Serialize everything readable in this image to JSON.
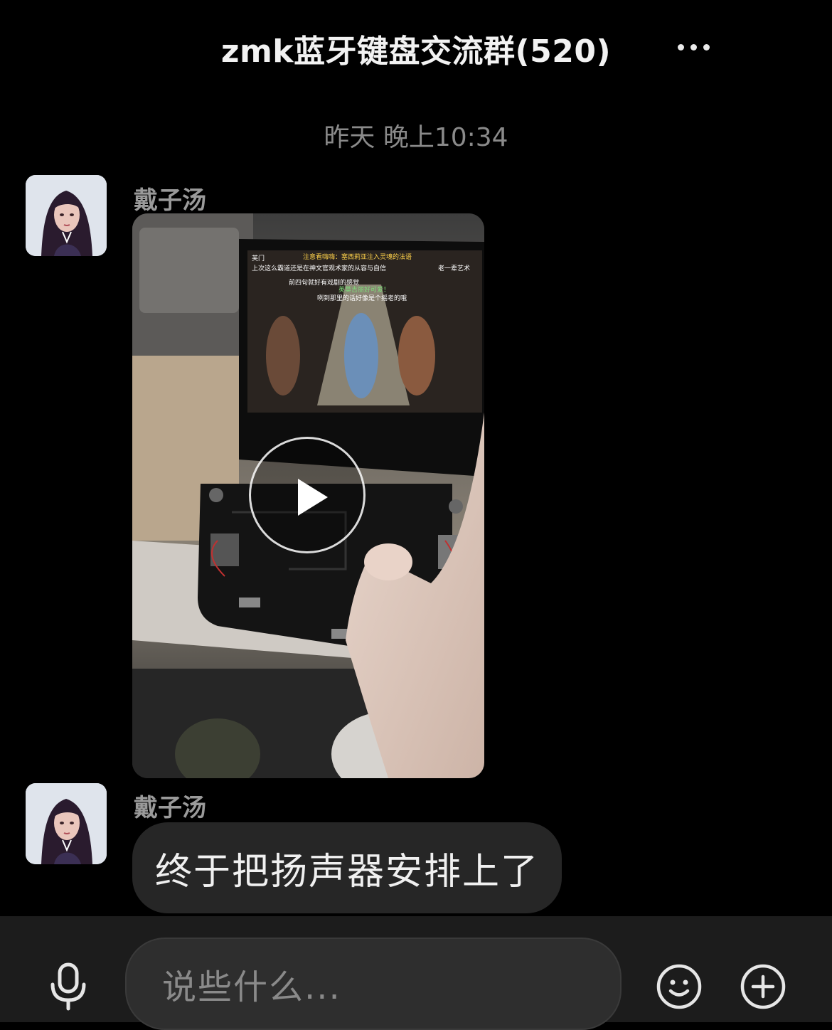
{
  "header": {
    "title": "zmk蓝牙键盘交流群(520)",
    "more_icon": "more-dots-icon"
  },
  "timestamp": "昨天 晚上10:34",
  "messages": [
    {
      "sender": "戴子汤",
      "type": "video",
      "play_icon": "play-icon",
      "video_overlay_text": {
        "line1": "注意看嗨嗨：塞西莉亚注入灵魂的法语",
        "line2": "上次这么霸道还是在神文官观术家的从容与自信",
        "line3": "前四句就好有戏剧的感觉",
        "line4": "英莫吉丽好可爱！",
        "line5": "咧到那里的话好像是个摇老的哦",
        "side_left_1": "芙门",
        "side_right_1": "老一辈艺术"
      }
    },
    {
      "sender": "戴子汤",
      "type": "text",
      "text": "终于把扬声器安排上了"
    }
  ],
  "input_bar": {
    "placeholder": "说些什么...",
    "mic_icon": "microphone-icon",
    "emoji_icon": "emoji-smile-icon",
    "plus_icon": "plus-circle-icon"
  },
  "colors": {
    "background": "#000000",
    "bubble": "#262626",
    "input_bar": "#1c1c1c",
    "input_field": "#2e2e2e",
    "secondary_text": "#8a8a8a"
  }
}
